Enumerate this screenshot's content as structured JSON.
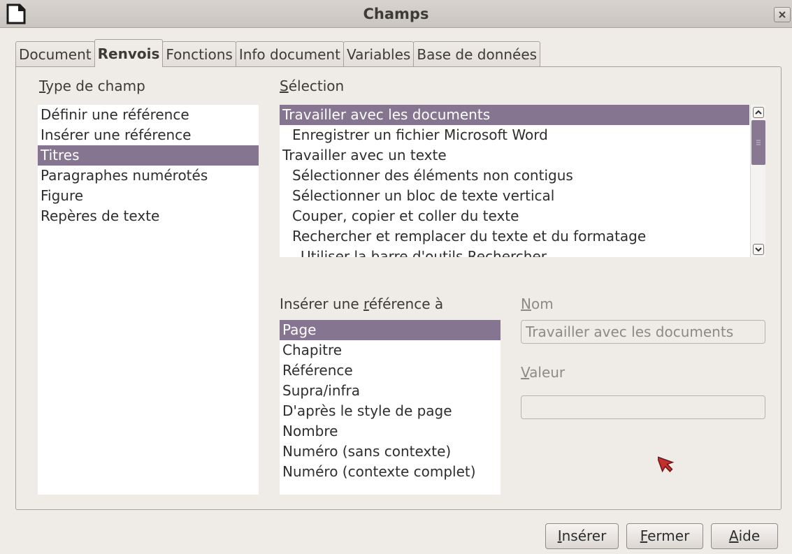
{
  "window": {
    "title": "Champs"
  },
  "tabs": [
    {
      "label": "Document"
    },
    {
      "label": "Renvois",
      "active": true
    },
    {
      "label": "Fonctions"
    },
    {
      "label": "Info document"
    },
    {
      "label": "Variables"
    },
    {
      "label": "Base de données"
    }
  ],
  "type_de_champ": {
    "label_mnemonic": "T",
    "label_rest": "ype de champ",
    "items": [
      {
        "label": "Définir une référence"
      },
      {
        "label": "Insérer une référence"
      },
      {
        "label": "Titres",
        "selected": true
      },
      {
        "label": "Paragraphes numérotés"
      },
      {
        "label": "Figure"
      },
      {
        "label": "Repères de texte"
      }
    ]
  },
  "selection": {
    "label_mnemonic": "S",
    "label_rest": "élection",
    "items": [
      {
        "label": "Travailler avec les documents",
        "selected": true,
        "level": 0
      },
      {
        "label": "Enregistrer un fichier Microsoft Word",
        "level": 1
      },
      {
        "label": "Travailler avec un texte",
        "level": 0
      },
      {
        "label": "Sélectionner des éléments non contigus",
        "level": 1
      },
      {
        "label": "Sélectionner un bloc de texte vertical",
        "level": 1
      },
      {
        "label": "Couper, copier et coller du texte",
        "level": 1
      },
      {
        "label": "Rechercher et remplacer du texte et du formatage",
        "level": 1
      },
      {
        "label": "Utiliser la barre d'outils Rechercher",
        "level": 2
      }
    ]
  },
  "inserer_reference": {
    "label_before": "Insérer une ",
    "label_mnemonic": "r",
    "label_after": "éférence à",
    "items": [
      {
        "label": "Page",
        "selected": true
      },
      {
        "label": "Chapitre"
      },
      {
        "label": "Référence"
      },
      {
        "label": "Supra/infra"
      },
      {
        "label": "D'après le style de page"
      },
      {
        "label": "Nombre"
      },
      {
        "label": "Numéro (sans contexte)"
      },
      {
        "label": "Numéro (contexte complet)"
      }
    ]
  },
  "nom": {
    "label_mnemonic": "N",
    "label_rest": "om",
    "value": "Travailler avec les documents"
  },
  "valeur": {
    "label_mnemonic": "V",
    "label_rest": "aleur",
    "value": ""
  },
  "buttons": {
    "inserer": {
      "mnemonic": "I",
      "rest": "nsérer"
    },
    "fermer": {
      "mnemonic": "F",
      "rest": "ermer"
    },
    "aide": {
      "mnemonic": "A",
      "rest": "ide"
    }
  },
  "colors": {
    "selection": "#857590",
    "background": "#efebe7"
  }
}
